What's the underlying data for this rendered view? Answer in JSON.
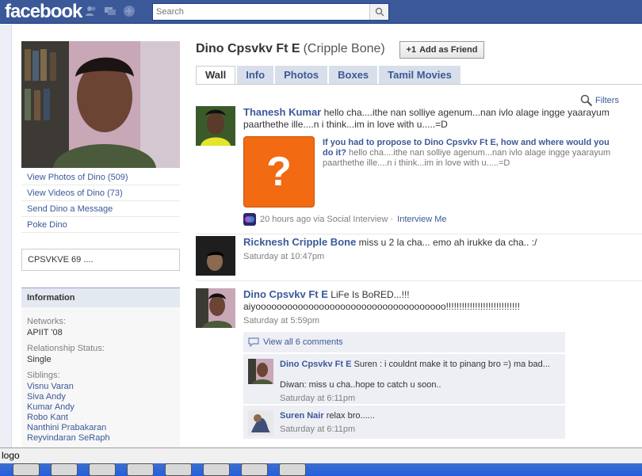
{
  "topbar": {
    "logo": "facebook",
    "icons": [
      "friends-icon",
      "messages-icon",
      "notifications-icon"
    ],
    "search_placeholder": "Search"
  },
  "profile": {
    "name": "Dino Cpsvkv Ft E",
    "nickname": "(Cripple Bone)",
    "add_friend": "Add as Friend",
    "tabs": [
      "Wall",
      "Info",
      "Photos",
      "Boxes",
      "Tamil Movies"
    ],
    "active_tab": "Wall"
  },
  "left": {
    "links": [
      "View Photos of Dino (509)",
      "View Videos of Dino (73)",
      "Send Dino a Message",
      "Poke Dino"
    ],
    "status": "CPSVKVE 69 ....",
    "info_title": "Information",
    "networks_label": "Networks:",
    "networks_value": "APIIT '08",
    "relationship_label": "Relationship Status:",
    "relationship_value": "Single",
    "siblings_label": "Siblings:",
    "siblings": [
      "Visnu Varan",
      "Siva Andy",
      "Kumar Andy",
      "Robo Kant",
      "Nanthini Prabakaran",
      "Reyvindaran SeRaph"
    ]
  },
  "filters": "Filters",
  "stories": {
    "s1": {
      "actor": "Thanesh Kumar",
      "msg": "hello cha....ithe nan solliye agenum...nan ivlo alage ingge yaarayum paarthethe ille....n i think...im in love with u.....=D",
      "q_title": "If you had to propose to Dino Cpsvkv Ft E, how and where would you do it?",
      "q_text": "hello cha....ithe nan solliye agenum...nan ivlo alage ingge yaarayum paarthethe ille....n i think...im in love with u.....=D",
      "q_mark": "?",
      "via": "20 hours ago via Social Interview ·",
      "via_link": "Interview Me"
    },
    "s2": {
      "actor": "Ricknesh Cripple Bone",
      "msg": "miss u 2 la cha... emo ah irukke da cha.. :/",
      "time": "Saturday at 10:47pm"
    },
    "s3": {
      "actor": "Dino Cpsvkv Ft E",
      "msg": "LiFe Is BoRED...!!! aiyoooooooooooooooooooooooooooooooooooo!!!!!!!!!!!!!!!!!!!!!!!!!!!!",
      "time": "Saturday at 5:59pm",
      "view_all": "View all 6 comments",
      "c1_name": "Dino Cpsvkv Ft E",
      "c1_text": "Suren : i couldnt make it to pinang bro =) ma bad...",
      "c1_text2": "Diwan: miss u cha..hope to catch u soon..",
      "c1_time": "Saturday at 6:11pm",
      "c2_name": "Suren Nair",
      "c2_text": "relax bro......",
      "c2_time": "Saturday at 6:11pm"
    }
  },
  "statusbar": "logo"
}
